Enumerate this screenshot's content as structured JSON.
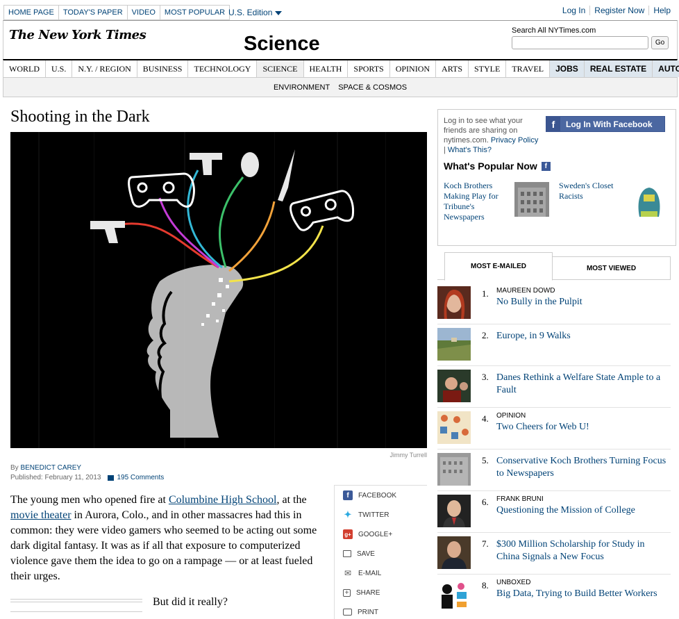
{
  "topbar": {
    "links": [
      "HOME PAGE",
      "TODAY'S PAPER",
      "VIDEO",
      "MOST POPULAR"
    ],
    "edition": "U.S. Edition",
    "account": [
      "Log In",
      "Register Now",
      "Help"
    ]
  },
  "masthead": {
    "logo": "The New York Times",
    "section": "Science",
    "search_label": "Search All NYTimes.com",
    "search_placeholder": "",
    "search_button": "Go"
  },
  "nav": {
    "items": [
      "WORLD",
      "U.S.",
      "N.Y. / REGION",
      "BUSINESS",
      "TECHNOLOGY",
      "SCIENCE",
      "HEALTH",
      "SPORTS",
      "OPINION",
      "ARTS",
      "STYLE",
      "TRAVEL",
      "JOBS",
      "REAL ESTATE",
      "AUTOS"
    ],
    "active": "SCIENCE",
    "sub": [
      "ENVIRONMENT",
      "SPACE & COSMOS"
    ]
  },
  "article": {
    "headline": "Shooting in the Dark",
    "photo_credit": "Jimmy Turrell",
    "byline_prefix": "By ",
    "author": "BENEDICT CAREY",
    "published": "Published: February 11, 2013",
    "comments": "195 Comments",
    "p1_a": "The young men who opened fire at ",
    "p1_link1": "Columbine High School",
    "p1_b": ", at the ",
    "p1_link2": "movie theater",
    "p1_c": " in Aurora, Colo., and in other massacres had this in common: they were video gamers who seemed to be acting out some dark digital fantasy. It was as if all that exposure to computerized violence gave them the idea to go on a rampage — or at least fueled their urges.",
    "pullquote": "But did it really?"
  },
  "share": [
    "FACEBOOK",
    "TWITTER",
    "GOOGLE+",
    "SAVE",
    "E-MAIL",
    "SHARE",
    "PRINT"
  ],
  "sidebar": {
    "fb_text": "Log in to see what your friends are sharing on nytimes.com.",
    "privacy": "Privacy Policy",
    "whats_this": "What's This?",
    "fb_button": "Log In With Facebook",
    "popular_title": "What's Popular Now",
    "popular": [
      "Koch Brothers Making Play for Tribune's Newspapers",
      "Sweden's Closet Racists"
    ],
    "tabs": [
      "MOST E-MAILED",
      "MOST VIEWED"
    ],
    "most": [
      {
        "num": "1.",
        "kicker": "MAUREEN DOWD",
        "head": "No Bully in the Pulpit"
      },
      {
        "num": "2.",
        "kicker": "",
        "head": "Europe, in 9 Walks"
      },
      {
        "num": "3.",
        "kicker": "",
        "head": "Danes Rethink a Welfare State Ample to a Fault"
      },
      {
        "num": "4.",
        "kicker": "OPINION",
        "head": "Two Cheers for Web U!"
      },
      {
        "num": "5.",
        "kicker": "",
        "head": "Conservative Koch Brothers Turning Focus to Newspapers"
      },
      {
        "num": "6.",
        "kicker": "FRANK BRUNI",
        "head": "Questioning the Mission of College"
      },
      {
        "num": "7.",
        "kicker": "",
        "head": "$300 Million Scholarship for Study in China Signals a New Focus"
      },
      {
        "num": "8.",
        "kicker": "UNBOXED",
        "head": "Big Data, Trying to Build Better Workers"
      }
    ]
  }
}
